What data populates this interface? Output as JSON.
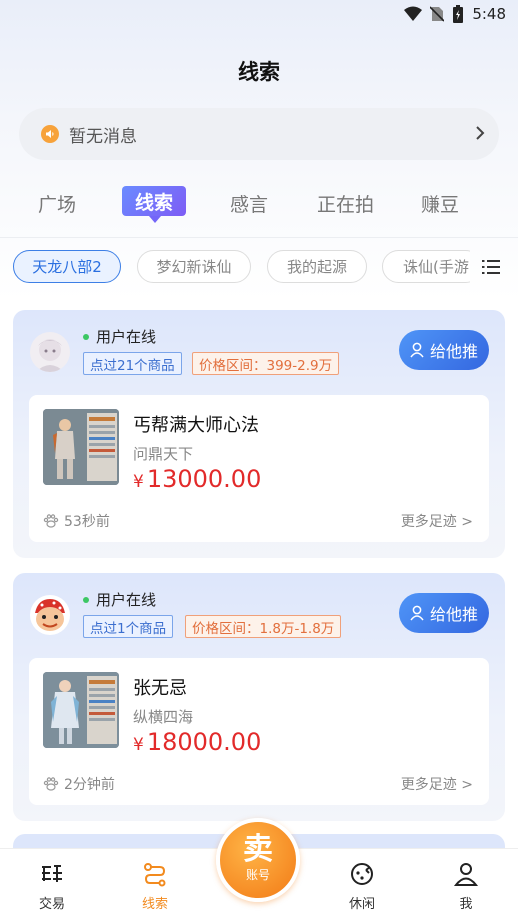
{
  "status_bar": {
    "time": "5:48"
  },
  "header": {
    "title": "线索"
  },
  "notice": {
    "text": "暂无消息"
  },
  "tabs": [
    {
      "label": "广场",
      "active": false
    },
    {
      "label": "线索",
      "active": true
    },
    {
      "label": "感言",
      "active": false
    },
    {
      "label": "正在拍",
      "active": false
    },
    {
      "label": "赚豆",
      "active": false
    }
  ],
  "game_filters": [
    {
      "label": "天龙八部2",
      "active": true
    },
    {
      "label": "梦幻新诛仙",
      "active": false
    },
    {
      "label": "我的起源",
      "active": false
    },
    {
      "label": "诛仙(手游",
      "active": false
    }
  ],
  "leads": [
    {
      "status": "用户在线",
      "viewed_tag": "点过21个商品",
      "price_range_tag": "价格区间：399-2.9万",
      "push_button": "给他推",
      "item": {
        "name": "丐帮满大师心法",
        "server": "问鼎天下",
        "currency": "¥",
        "price": "13000.00"
      },
      "time_ago": "53秒前",
      "more_link": "更多足迹 >"
    },
    {
      "status": "用户在线",
      "viewed_tag": "点过1个商品",
      "price_range_tag": "价格区间：1.8万-1.8万",
      "push_button": "给他推",
      "item": {
        "name": "张无忌",
        "server": "纵横四海",
        "currency": "¥",
        "price": "18000.00"
      },
      "time_ago": "2分钟前",
      "more_link": "更多足迹 >"
    }
  ],
  "bottom_nav": {
    "items": [
      {
        "label": "交易",
        "icon": "trade-icon"
      },
      {
        "label": "线索",
        "icon": "clue-icon",
        "active": true
      },
      {
        "label": "休闲",
        "icon": "game-icon"
      },
      {
        "label": "我",
        "icon": "profile-icon"
      }
    ],
    "sell": {
      "big": "卖",
      "small": "账号"
    }
  },
  "colors": {
    "accent": "#f28a1e",
    "tab_active": "#7466f8",
    "price": "#e22a2a",
    "push_button": "#3c78ec"
  }
}
